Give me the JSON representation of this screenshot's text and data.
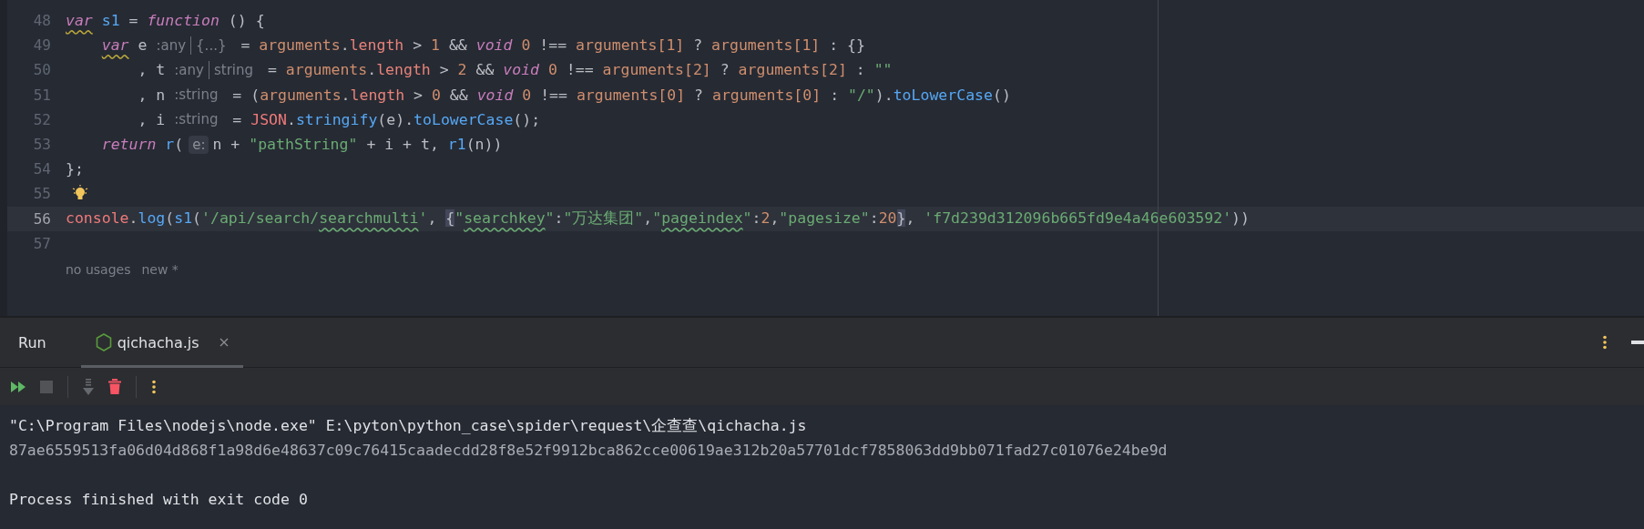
{
  "editor": {
    "lines": [
      {
        "number": "48",
        "current": false,
        "segments": [
          {
            "kind": "code",
            "tokens": [
              {
                "kind": "keywordwarn",
                "text": "var"
              },
              {
                "kind": "function",
                "text": " s1"
              },
              {
                "kind": "plain",
                "text": " = "
              },
              {
                "kind": "keyword",
                "text": "function"
              },
              {
                "kind": "plain",
                "text": " () {"
              }
            ]
          }
        ]
      },
      {
        "number": "49",
        "current": false,
        "segments": [
          {
            "kind": "code",
            "tokens": [
              {
                "kind": "keywordwarn",
                "text": "    var"
              },
              {
                "kind": "plain",
                "text": " e"
              }
            ]
          },
          {
            "kind": "hint",
            "text": ":any",
            "alt": "{...}"
          },
          {
            "kind": "code",
            "tokens": [
              {
                "kind": "plain",
                "text": " = "
              },
              {
                "kind": "builtin",
                "text": "arguments"
              },
              {
                "kind": "plain",
                "text": "."
              },
              {
                "kind": "property",
                "text": "length"
              },
              {
                "kind": "plain",
                "text": " > "
              },
              {
                "kind": "number",
                "text": "1"
              },
              {
                "kind": "plain",
                "text": " && "
              },
              {
                "kind": "keyword",
                "text": "void"
              },
              {
                "kind": "number",
                "text": " 0"
              },
              {
                "kind": "plain",
                "text": " !== "
              },
              {
                "kind": "builtin",
                "text": "arguments[1]"
              },
              {
                "kind": "plain",
                "text": " ? "
              },
              {
                "kind": "builtin",
                "text": "arguments[1]"
              },
              {
                "kind": "plain",
                "text": " : {}"
              }
            ]
          }
        ]
      },
      {
        "number": "50",
        "current": false,
        "segments": [
          {
            "kind": "code",
            "tokens": [
              {
                "kind": "plain",
                "text": "        , t"
              }
            ]
          },
          {
            "kind": "hint",
            "text": ":any",
            "alt": "string"
          },
          {
            "kind": "code",
            "tokens": [
              {
                "kind": "plain",
                "text": " = "
              },
              {
                "kind": "builtin",
                "text": "arguments"
              },
              {
                "kind": "plain",
                "text": "."
              },
              {
                "kind": "property",
                "text": "length"
              },
              {
                "kind": "plain",
                "text": " > "
              },
              {
                "kind": "number",
                "text": "2"
              },
              {
                "kind": "plain",
                "text": " && "
              },
              {
                "kind": "keyword",
                "text": "void"
              },
              {
                "kind": "number",
                "text": " 0"
              },
              {
                "kind": "plain",
                "text": " !== "
              },
              {
                "kind": "builtin",
                "text": "arguments[2]"
              },
              {
                "kind": "plain",
                "text": " ? "
              },
              {
                "kind": "builtin",
                "text": "arguments[2]"
              },
              {
                "kind": "plain",
                "text": " : "
              },
              {
                "kind": "string",
                "text": "\"\""
              }
            ]
          }
        ]
      },
      {
        "number": "51",
        "current": false,
        "segments": [
          {
            "kind": "code",
            "tokens": [
              {
                "kind": "plain",
                "text": "        , n"
              }
            ]
          },
          {
            "kind": "hint",
            "text": ":string"
          },
          {
            "kind": "code",
            "tokens": [
              {
                "kind": "plain",
                "text": " = ("
              },
              {
                "kind": "builtin",
                "text": "arguments"
              },
              {
                "kind": "plain",
                "text": "."
              },
              {
                "kind": "property",
                "text": "length"
              },
              {
                "kind": "plain",
                "text": " > "
              },
              {
                "kind": "number",
                "text": "0"
              },
              {
                "kind": "plain",
                "text": " && "
              },
              {
                "kind": "keyword",
                "text": "void"
              },
              {
                "kind": "number",
                "text": " 0"
              },
              {
                "kind": "plain",
                "text": " !== "
              },
              {
                "kind": "builtin",
                "text": "arguments[0]"
              },
              {
                "kind": "plain",
                "text": " ? "
              },
              {
                "kind": "builtin",
                "text": "arguments[0]"
              },
              {
                "kind": "plain",
                "text": " : "
              },
              {
                "kind": "string",
                "text": "\"/\""
              },
              {
                "kind": "plain",
                "text": ")."
              },
              {
                "kind": "function",
                "text": "toLowerCase"
              },
              {
                "kind": "plain",
                "text": "()"
              }
            ]
          }
        ]
      },
      {
        "number": "52",
        "current": false,
        "segments": [
          {
            "kind": "code",
            "tokens": [
              {
                "kind": "plain",
                "text": "        , i"
              }
            ]
          },
          {
            "kind": "hint",
            "text": ":string"
          },
          {
            "kind": "code",
            "tokens": [
              {
                "kind": "plain",
                "text": " = "
              },
              {
                "kind": "global",
                "text": "JSON"
              },
              {
                "kind": "plain",
                "text": "."
              },
              {
                "kind": "function",
                "text": "stringify"
              },
              {
                "kind": "plain",
                "text": "(e)."
              },
              {
                "kind": "function",
                "text": "toLowerCase"
              },
              {
                "kind": "plain",
                "text": "();"
              }
            ]
          }
        ]
      },
      {
        "number": "53",
        "current": false,
        "segments": [
          {
            "kind": "code",
            "tokens": [
              {
                "kind": "keyword",
                "text": "    return"
              },
              {
                "kind": "function",
                "text": " r"
              },
              {
                "kind": "plain",
                "text": "("
              }
            ]
          },
          {
            "kind": "param",
            "text": "e:"
          },
          {
            "kind": "code",
            "tokens": [
              {
                "kind": "plain",
                "text": "n + "
              },
              {
                "kind": "string",
                "text": "\"pathString\""
              },
              {
                "kind": "plain",
                "text": " + i + t, "
              },
              {
                "kind": "function",
                "text": "r1"
              },
              {
                "kind": "plain",
                "text": "(n))"
              }
            ]
          }
        ]
      },
      {
        "number": "54",
        "current": false,
        "segments": [
          {
            "kind": "code",
            "tokens": [
              {
                "kind": "plain",
                "text": "};"
              }
            ]
          }
        ]
      },
      {
        "number": "55",
        "current": false,
        "segments": [
          {
            "kind": "bulb"
          }
        ]
      },
      {
        "number": "56",
        "current": true,
        "segments": [
          {
            "kind": "code",
            "tokens": [
              {
                "kind": "global",
                "text": "console"
              },
              {
                "kind": "plain",
                "text": "."
              },
              {
                "kind": "function",
                "text": "log"
              },
              {
                "kind": "plain",
                "text": "("
              },
              {
                "kind": "function",
                "text": "s1"
              },
              {
                "kind": "plain",
                "text": "("
              },
              {
                "kind": "string",
                "text": "'/api/search/"
              },
              {
                "kind": "stringtypo",
                "text": "searchmulti"
              },
              {
                "kind": "string",
                "text": "'"
              },
              {
                "kind": "plain",
                "text": ", "
              },
              {
                "kind": "brace",
                "text": "{"
              },
              {
                "kind": "string",
                "text": "\""
              },
              {
                "kind": "stringtypo",
                "text": "searchkey"
              },
              {
                "kind": "string",
                "text": "\""
              },
              {
                "kind": "plain",
                "text": ":"
              },
              {
                "kind": "string",
                "text": "\"万达集团\""
              },
              {
                "kind": "plain",
                "text": ","
              },
              {
                "kind": "string",
                "text": "\""
              },
              {
                "kind": "stringtypo",
                "text": "pageindex"
              },
              {
                "kind": "string",
                "text": "\""
              },
              {
                "kind": "plain",
                "text": ":"
              },
              {
                "kind": "number",
                "text": "2"
              },
              {
                "kind": "plain",
                "text": ","
              },
              {
                "kind": "string",
                "text": "\"pagesize\""
              },
              {
                "kind": "plain",
                "text": ":"
              },
              {
                "kind": "number",
                "text": "20"
              },
              {
                "kind": "brace",
                "text": "}"
              },
              {
                "kind": "plain",
                "text": ", "
              },
              {
                "kind": "string",
                "text": "'f7d239d312096b665fd9e4a46e603592'"
              },
              {
                "kind": "plain",
                "text": "))"
              }
            ]
          }
        ]
      },
      {
        "number": "57",
        "current": false
      }
    ],
    "usage_hints": [
      "no usages",
      "new *"
    ]
  },
  "run_panel": {
    "title": "Run",
    "tabs": [
      {
        "label": "qichacha.js",
        "selected": true
      }
    ],
    "toolbar": [
      {
        "kind": "rerun",
        "disabled": false
      },
      {
        "kind": "stop",
        "disabled": true
      },
      {
        "kind": "separator"
      },
      {
        "kind": "scroll",
        "disabled": true
      },
      {
        "kind": "clear",
        "disabled": false
      },
      {
        "kind": "separator"
      },
      {
        "kind": "more",
        "disabled": false
      }
    ],
    "console": [
      {
        "kind": "command",
        "text": "\"C:\\Program Files\\nodejs\\node.exe\" E:\\pyton\\python_case\\spider\\request\\企查查\\qichacha.js"
      },
      {
        "kind": "output",
        "text": "87ae6559513fa06d04d868f1a98d6e48637c09c76415caadecdd28f8e52f9912bca862cce00619ae312b20a57701dcf7858063dd9bb071fad27c01076e24be9d"
      },
      {
        "kind": "exit",
        "text": "Process finished with exit code 0"
      }
    ]
  }
}
